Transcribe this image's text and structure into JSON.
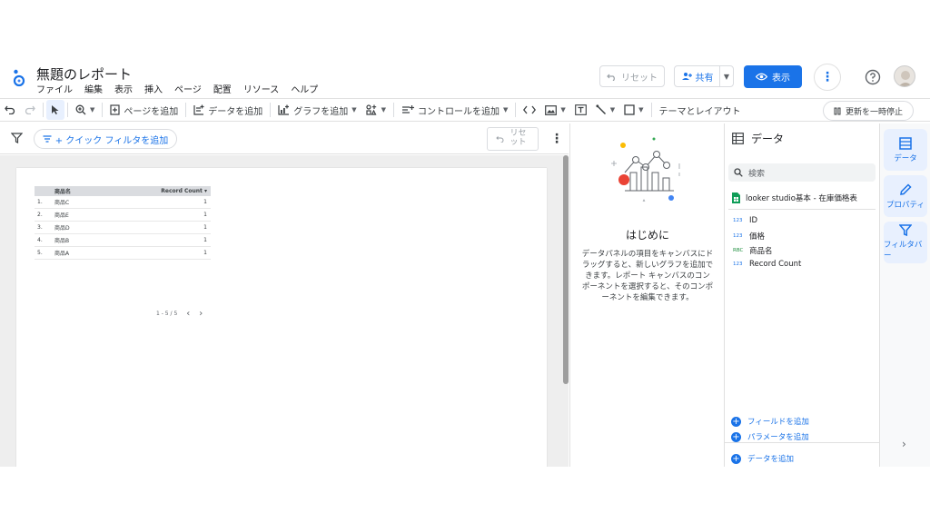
{
  "header": {
    "title": "無題のレポート",
    "menu": [
      "ファイル",
      "編集",
      "表示",
      "挿入",
      "ページ",
      "配置",
      "リソース",
      "ヘルプ"
    ],
    "reset_label": "リセット",
    "share_label": "共有",
    "view_label": "表示"
  },
  "toolbar": {
    "add_page": "ページを追加",
    "add_data": "データを追加",
    "add_chart": "グラフを追加",
    "add_control": "コントロールを追加",
    "theme_layout": "テーマとレイアウト",
    "pause_updates": "更新を一時停止"
  },
  "filterbar": {
    "quick_filter": "+ クイック フィルタを追加",
    "reset_line1": "リセ",
    "reset_line2": "ット"
  },
  "table": {
    "columns": [
      "商品名",
      "Record Count ▾"
    ],
    "rows": [
      {
        "idx": "1.",
        "name": "商品C",
        "count": "1"
      },
      {
        "idx": "2.",
        "name": "商品E",
        "count": "1"
      },
      {
        "idx": "3.",
        "name": "商品D",
        "count": "1"
      },
      {
        "idx": "4.",
        "name": "商品B",
        "count": "1"
      },
      {
        "idx": "5.",
        "name": "商品A",
        "count": "1"
      }
    ],
    "pager": "1 - 5 / 5"
  },
  "start_panel": {
    "title": "はじめに",
    "description": "データパネルの項目をキャンバスにドラッグすると、新しいグラフを追加できます。レポート キャンバスのコンポーネントを選択すると、そのコンポーネントを編集できます。"
  },
  "data_panel": {
    "title": "データ",
    "search_placeholder": "検索",
    "source": "looker studio基本 - 在庫価格表",
    "fields": [
      {
        "type": "123",
        "name": "ID"
      },
      {
        "type": "123",
        "name": "価格"
      },
      {
        "type": "RBC",
        "name": "商品名"
      },
      {
        "type": "123",
        "name": "Record Count"
      }
    ],
    "add_field": "フィールドを追加",
    "add_parameter": "パラメータを追加",
    "add_data": "データを追加"
  },
  "rail": {
    "data": "データ",
    "properties": "プロパティ",
    "filter_bar": "フィルタバー"
  },
  "colors": {
    "accent": "#1a73e8",
    "canvas_bg": "#eeeeee"
  }
}
